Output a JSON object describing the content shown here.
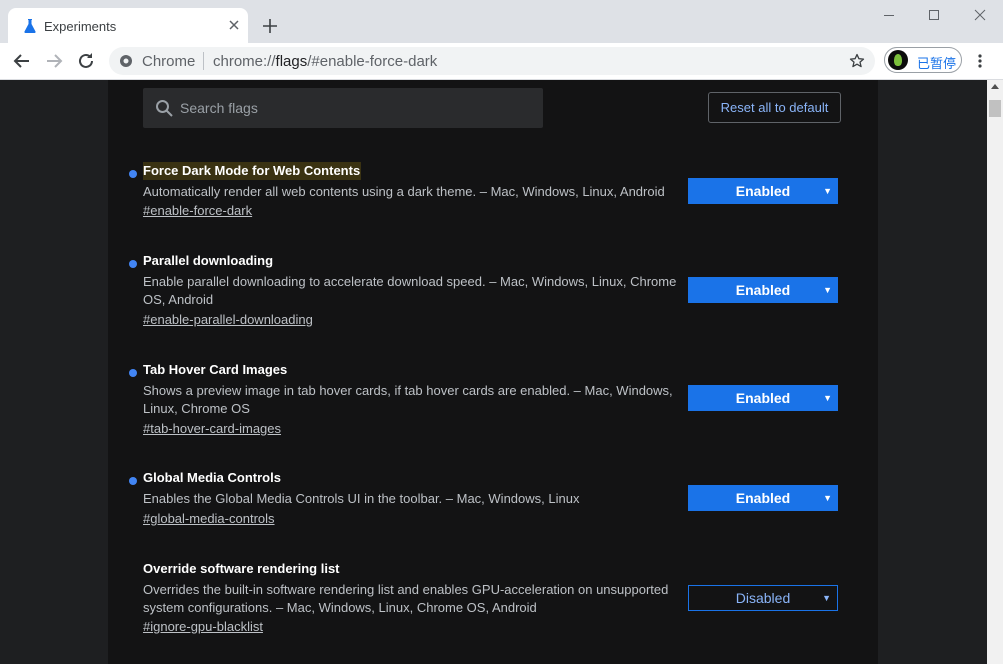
{
  "tab": {
    "title": "Experiments"
  },
  "omnibox": {
    "chip": "Chrome",
    "url_prefix": "chrome://",
    "url_host": "flags",
    "url_suffix": "/#enable-force-dark"
  },
  "profile": {
    "label": "已暂停"
  },
  "search": {
    "placeholder": "Search flags"
  },
  "reset_label": "Reset all to default",
  "flags": [
    {
      "title": "Force Dark Mode for Web Contents",
      "desc": "Automatically render all web contents using a dark theme. – Mac, Windows, Linux, Android",
      "link": "#enable-force-dark",
      "state": "Enabled",
      "modified": true
    },
    {
      "title": "Parallel downloading",
      "desc": "Enable parallel downloading to accelerate download speed. – Mac, Windows, Linux, Chrome OS, Android",
      "link": "#enable-parallel-downloading",
      "state": "Enabled",
      "modified": true
    },
    {
      "title": "Tab Hover Card Images",
      "desc": "Shows a preview image in tab hover cards, if tab hover cards are enabled. – Mac, Windows, Linux, Chrome OS",
      "link": "#tab-hover-card-images",
      "state": "Enabled",
      "modified": true
    },
    {
      "title": "Global Media Controls",
      "desc": "Enables the Global Media Controls UI in the toolbar. – Mac, Windows, Linux",
      "link": "#global-media-controls",
      "state": "Enabled",
      "modified": true
    },
    {
      "title": "Override software rendering list",
      "desc": "Overrides the built-in software rendering list and enables GPU-acceleration on unsupported system configurations. – Mac, Windows, Linux, Chrome OS, Android",
      "link": "#ignore-gpu-blacklist",
      "state": "Disabled",
      "modified": false
    }
  ],
  "colors": {
    "accent": "#1a73e8",
    "link": "#8ab4f8",
    "background": "#131314",
    "modified_dot": "#4285f4"
  }
}
